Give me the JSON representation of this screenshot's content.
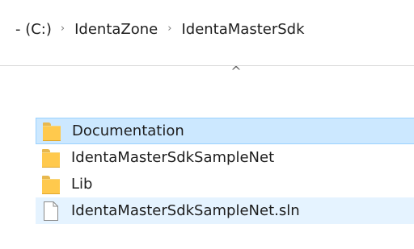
{
  "breadcrumb": {
    "root": "- (C:)",
    "items": [
      "IdentaZone",
      "IdentaMasterSdk"
    ],
    "separator": "›"
  },
  "sort_indicator": "^",
  "files": [
    {
      "name": "Documentation",
      "type": "folder",
      "state": "selected"
    },
    {
      "name": "IdentaMasterSdkSampleNet",
      "type": "folder",
      "state": "normal"
    },
    {
      "name": "Lib",
      "type": "folder",
      "state": "normal"
    },
    {
      "name": "IdentaMasterSdkSampleNet.sln",
      "type": "file",
      "state": "hover"
    }
  ],
  "colors": {
    "selected_bg": "#cce8ff",
    "selected_border": "#99d1ff",
    "hover_bg": "#e5f3ff",
    "folder": "#ffc94d"
  }
}
